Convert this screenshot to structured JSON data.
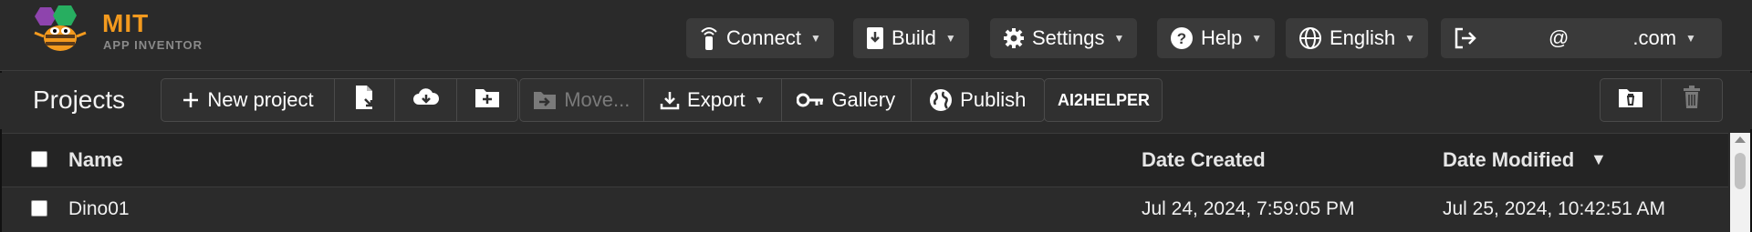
{
  "colors": {
    "brand": "#f39a1e",
    "background": "#2b2b2b",
    "button": "#3a3a3a"
  },
  "app": {
    "logo_title": "MIT",
    "logo_subtitle": "APP INVENTOR"
  },
  "topnav": {
    "connect": "Connect",
    "build": "Build",
    "settings": "Settings",
    "help": "Help",
    "language": "English",
    "user_at": "@",
    "user_domain": ".com"
  },
  "toolbar": {
    "title": "Projects",
    "new_project": "New project",
    "move": "Move...",
    "export": "Export",
    "gallery": "Gallery",
    "publish": "Publish",
    "ai2helper": "AI2HELPER"
  },
  "table": {
    "columns": {
      "name": "Name",
      "date_created": "Date Created",
      "date_modified": "Date Modified",
      "sort_indicator": "▼"
    },
    "rows": [
      {
        "name": "Dino01",
        "date_created": "Jul 24, 2024, 7:59:05 PM",
        "date_modified": "Jul 25, 2024, 10:42:51 AM"
      }
    ]
  },
  "icons": {
    "connect": "wifi-phone-icon",
    "build": "build-phone-icon",
    "settings": "gear-icon",
    "help": "question-icon",
    "language": "globe-icon",
    "logout": "logout-icon"
  }
}
